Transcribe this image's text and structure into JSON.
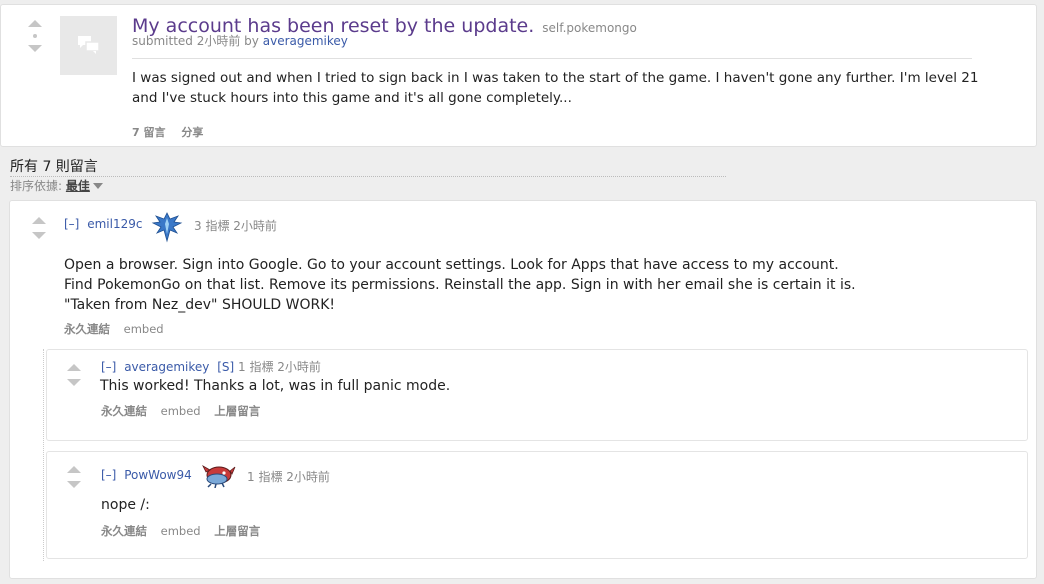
{
  "post": {
    "title": "My account has been reset by the update.",
    "domain": "self.pokemongo",
    "submitted_prefix": "submitted 2小時前 by",
    "author": "averagemikey",
    "selftext": "I was signed out and when I tried to sign back in I was taken to the start of the game. I haven't gone any further. I'm level 21 and I've stuck hours into this game and it's all gone completely...",
    "comments_label": "7 留言",
    "share_label": "分享"
  },
  "comments_header": {
    "title": "所有 7 則留言",
    "sort_prefix": "排序依據:",
    "sort_value": "最佳"
  },
  "comments": [
    {
      "expand": "[–]",
      "author": "emil129c",
      "meta": "3 指標 2小時前",
      "body": "Open a browser. Sign into Google. Go to your account settings. Look for Apps that have access to my account. Find PokemonGo on that list. Remove its permissions. Reinstall the app. Sign in with her email she is certain it is. \"Taken from Nez_dev\" SHOULD WORK!",
      "permalink": "永久連結",
      "embed": "embed",
      "flair_icon": "team-mystic-icon"
    },
    {
      "expand": "[–]",
      "author": "averagemikey",
      "submitter": "[S]",
      "meta": "1 指標 2小時前",
      "body": "This worked! Thanks a lot, was in full panic mode.",
      "permalink": "永久連結",
      "embed": "embed",
      "parent": "上層留言"
    },
    {
      "expand": "[–]",
      "author": "PowWow94",
      "meta": "1 指標 2小時前",
      "body": "nope /:",
      "permalink": "永久連結",
      "embed": "embed",
      "parent": "上層留言",
      "flair_icon": "pokemon-flair-icon"
    }
  ],
  "colors": {
    "title": "#5b3b8c",
    "link": "#3a5aa8",
    "muted": "#888888",
    "mystic_blue": "#3a78c8"
  }
}
